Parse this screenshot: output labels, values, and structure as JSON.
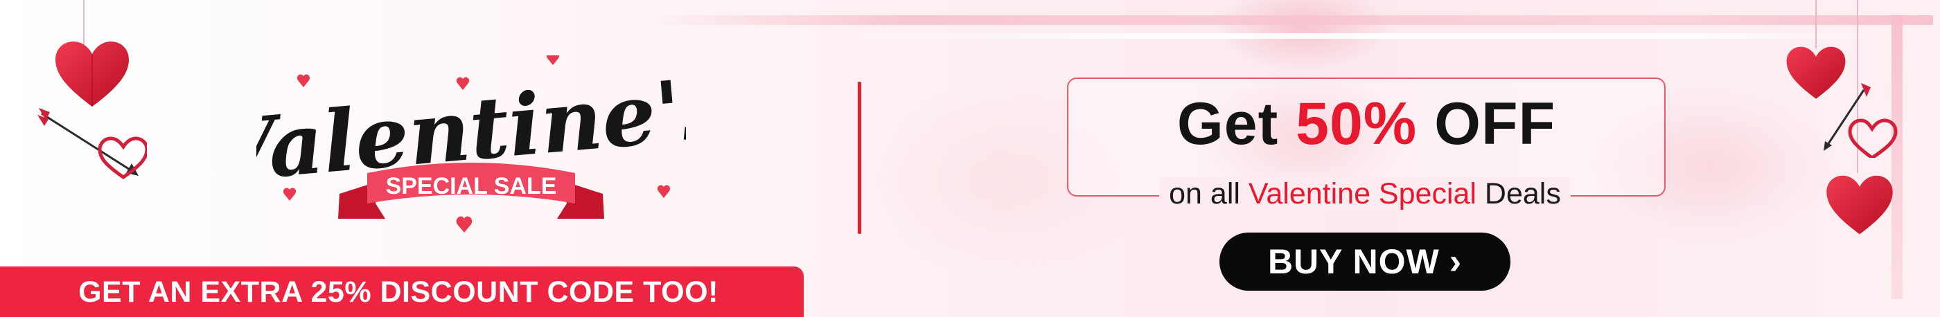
{
  "logo": {
    "script_text": "Valentine's",
    "ribbon_text": "SPECIAL SALE"
  },
  "offer": {
    "headline_prefix": "Get ",
    "headline_accent": "50%",
    "headline_suffix": " OFF",
    "sub_prefix": "on all ",
    "sub_accent": "Valentine Special",
    "sub_suffix": " Deals"
  },
  "cta": {
    "label": "BUY NOW",
    "icon": "chevron-right-icon"
  },
  "extra": {
    "text": "GET AN EXTRA 25% DISCOUNT CODE TOO!"
  },
  "colors": {
    "accent": "#e8192e",
    "bar": "#ed2540",
    "button": "#0a0a0a",
    "text": "#141414",
    "background": "#fdf2f4"
  }
}
